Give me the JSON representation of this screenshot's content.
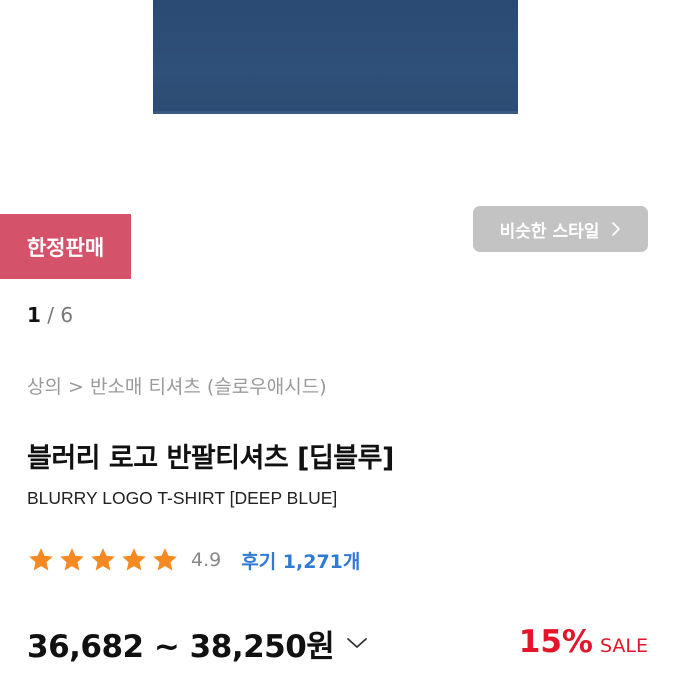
{
  "badge": {
    "label": "한정판매"
  },
  "similar_style": {
    "label": "비슷한 스타일"
  },
  "gallery": {
    "current": "1",
    "separator": "/",
    "total": "6"
  },
  "breadcrumb": "상의 > 반소매 티셔츠 (슬로우애시드)",
  "product": {
    "name_ko": "블러리 로고 반팔티셔츠 [딥블루]",
    "name_en": "BLURRY LOGO T-SHIRT [DEEP BLUE]"
  },
  "rating": {
    "stars": 5,
    "score": "4.9",
    "reviews_label": "후기 1,271개"
  },
  "price": {
    "range": "36,682 ~ 38,250원",
    "discount": "15%",
    "sale_label": "SALE"
  },
  "colors": {
    "badge_bg": "#d5536a",
    "similar_bg": "#c3c3c3",
    "star": "#f58a23",
    "review_link": "#2f7bd4",
    "discount": "#e3152a",
    "shirt": "#2d4c75"
  },
  "icons": {
    "similar_chevron": "chevron-right-icon",
    "price_toggle": "chevron-down-icon",
    "star": "star-icon"
  }
}
